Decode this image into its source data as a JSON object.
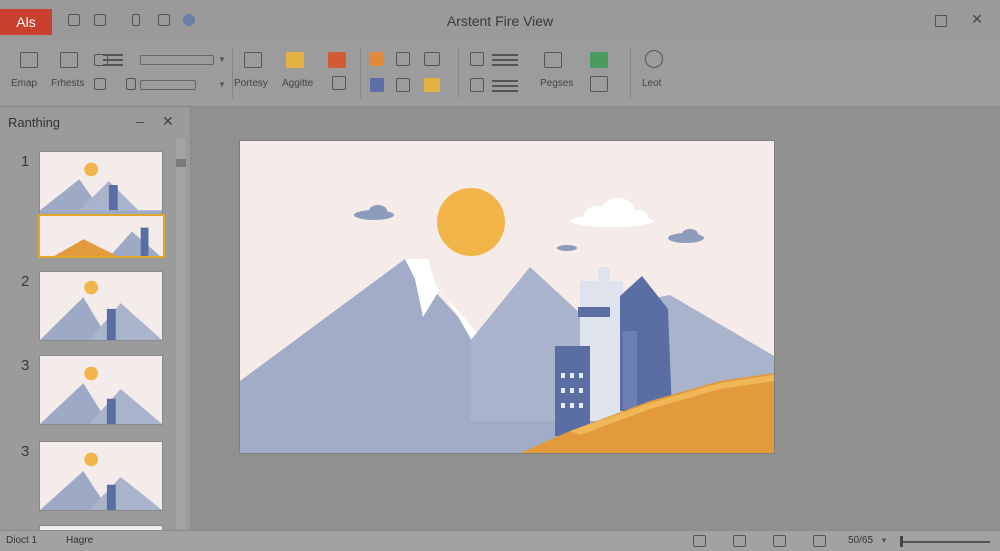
{
  "window": {
    "app_badge": "Als",
    "title": "Arstent Fire View"
  },
  "ribbon": {
    "labels": [
      "Emap",
      "Frhests",
      "Portesy",
      "Aggitte",
      "Pegses",
      "Leot"
    ]
  },
  "slides_panel": {
    "title": "Ranthing",
    "slide_numbers": [
      "1",
      "2",
      "3",
      "3"
    ]
  },
  "statusbar": {
    "left_text": "Dioct 1",
    "section_text": "Hagre",
    "zoom_text": "50/65"
  },
  "colors": {
    "app_badge": "#c9402e",
    "sun": "#f2b54a",
    "mountain": "#9ea9c6",
    "building": "#5a6ea3",
    "hill": "#e19a3c",
    "slide_bg": "#f5ebe8",
    "thumb_selection": "#e0a82a"
  }
}
